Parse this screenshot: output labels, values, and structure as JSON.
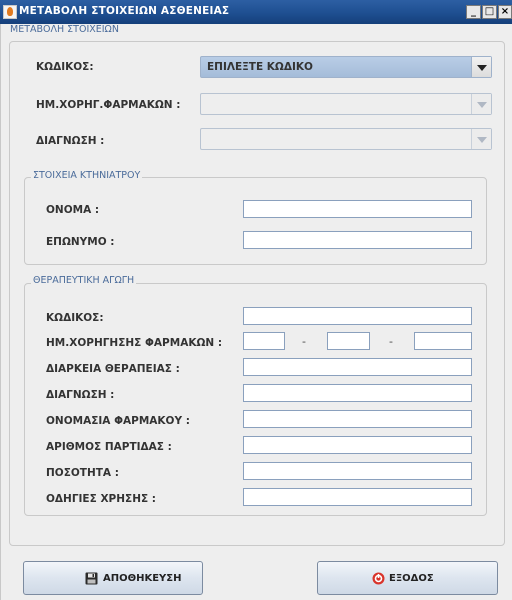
{
  "window": {
    "title": "ΜΕΤΑΒΟΛΗ ΣΤΟΙΧΕΙΩΝ ΑΣΘΕΝΕΙΑΣ",
    "minimize": "_",
    "maximize": "□",
    "close": "×"
  },
  "main_group": {
    "legend": "ΜΕΤΑΒΟΛΗ ΣΤΟΙΧΕΙΩΝ",
    "code_label": "ΚΩΔΙΚΟΣ:",
    "code_value": "ΕΠΙΛΕΞΤΕ ΚΩΔΙΚΟ",
    "date_label": "ΗΜ.ΧΟΡΗΓ.ΦΑΡΜΑΚΩΝ :",
    "date_value": "",
    "diagnosis_label": "ΔΙΑΓΝΩΣΗ :",
    "diagnosis_value": ""
  },
  "vet_group": {
    "legend": "ΣΤΟΙΧΕΙΑ ΚΤΗΝΙΑΤΡΟΥ",
    "name_label": "ΟΝΟΜΑ :",
    "name_value": "",
    "surname_label": "ΕΠΩΝΥΜΟ :",
    "surname_value": ""
  },
  "therapy_group": {
    "legend": "ΘΕΡΑΠΕΥΤΙΚΗ ΑΓΩΓΗ",
    "code_label": "ΚΩΔΙΚΟΣ:",
    "date_label": "ΗΜ.ΧΟΡΗΓΗΣΗΣ ΦΑΡΜΑΚΩΝ :",
    "date_sep": "-",
    "duration_label": "ΔΙΑΡΚΕΙΑ ΘΕΡΑΠΕΙΑΣ :",
    "diagnosis_label": "ΔΙΑΓΝΩΣΗ :",
    "drug_name_label": "ΟΝΟΜΑΣΙΑ ΦΑΡΜΑΚΟΥ :",
    "batch_label": "ΑΡΙΘΜΟΣ ΠΑΡΤΙΔΑΣ :",
    "quantity_label": "ΠΟΣΟΤΗΤΑ :",
    "instructions_label": "ΟΔΗΓΙΕΣ ΧΡΗΣΗΣ :"
  },
  "buttons": {
    "save_label": "ΑΠΟΘΗΚΕΥΣΗ",
    "save_icon": "floppy-disk-icon",
    "exit_label": "ΕΞΟΔΟΣ",
    "exit_icon": "exit-icon",
    "exit_icon_color": "#d9342b"
  },
  "colors": {
    "titlebar": "#1e4f91",
    "combo_active": "#a4bcd9",
    "legend_text": "#4a6b9a"
  }
}
